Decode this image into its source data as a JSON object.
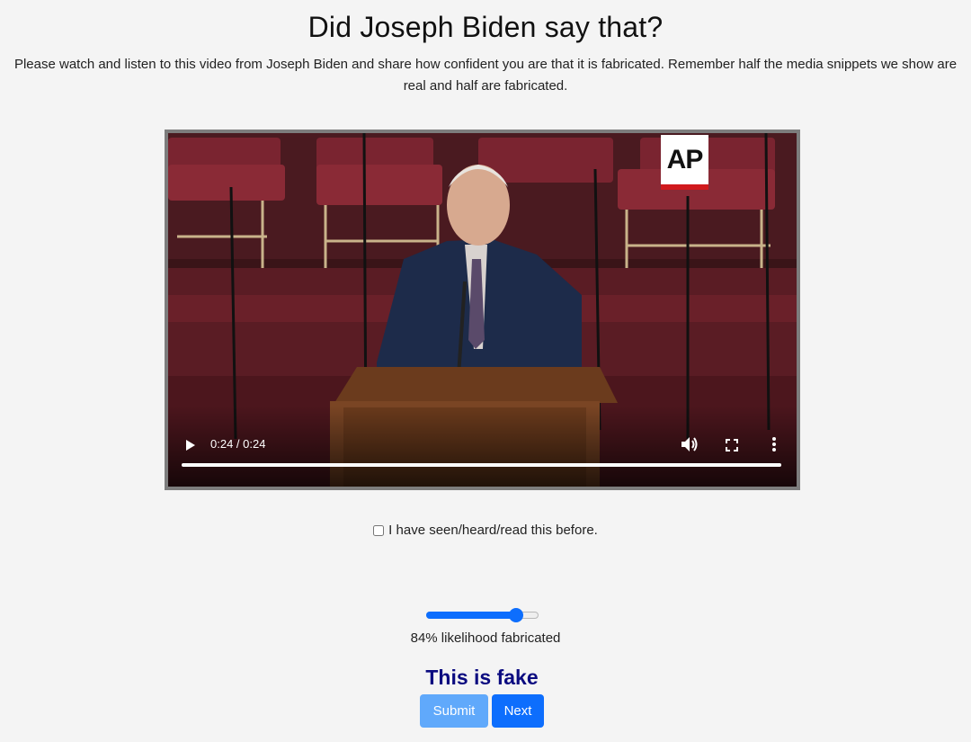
{
  "header": {
    "title": "Did Joseph Biden say that?",
    "instructions": "Please watch and listen to this video from Joseph Biden and share how confident you are that it is fabricated. Remember half the media snippets we show are real and half are fabricated."
  },
  "video": {
    "logo_text": "AP",
    "time": "0:24 / 0:24",
    "progress": 1.0,
    "icons": [
      "play-icon",
      "volume-icon",
      "fullscreen-icon",
      "more-icon"
    ]
  },
  "seen_checkbox": {
    "label": "I have seen/heard/read this before.",
    "checked": false
  },
  "slider": {
    "value": 84,
    "max": 100,
    "caption": "84% likelihood fabricated"
  },
  "verdict": "This is fake",
  "buttons": {
    "submit_label": "Submit",
    "next_label": "Next"
  },
  "colors": {
    "background": "#f4f4f4",
    "accent": "#0d6efd",
    "submit_disabled": "#60a9fb",
    "verdict": "#0b0b80"
  }
}
